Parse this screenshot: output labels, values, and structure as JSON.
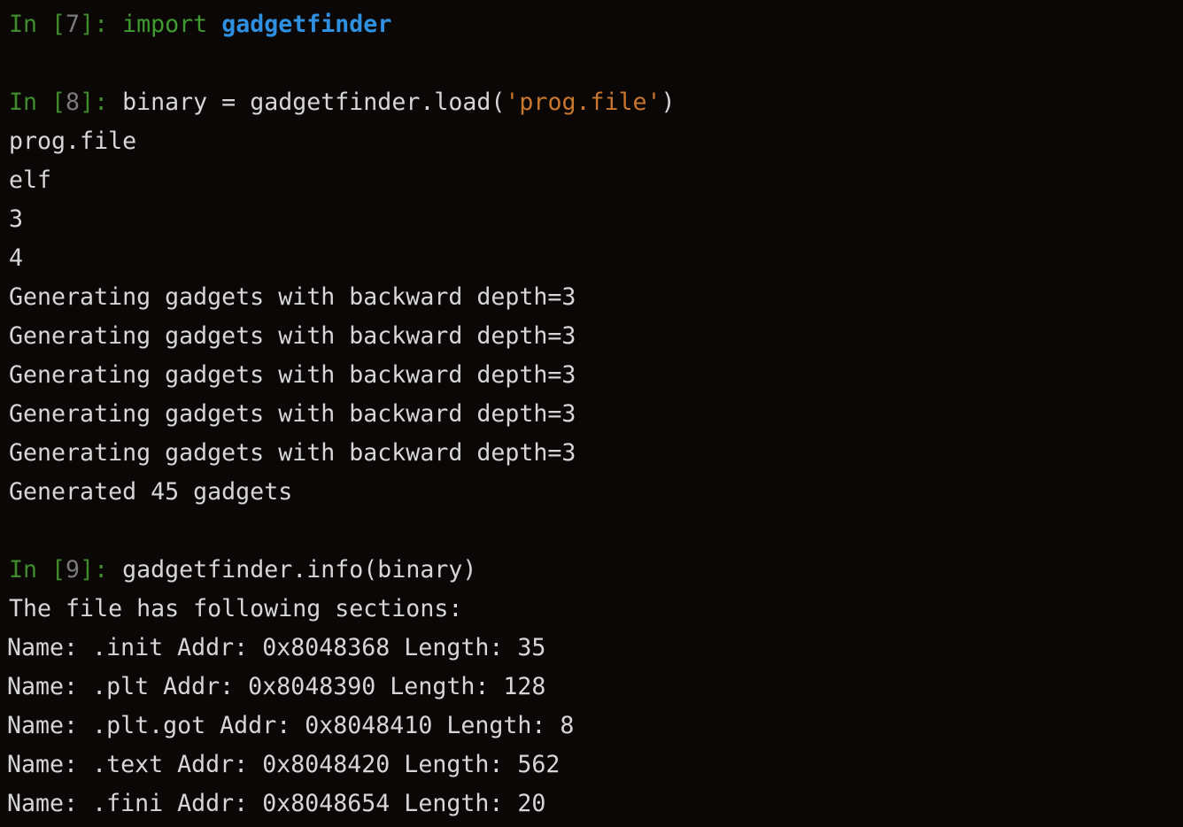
{
  "cells": [
    {
      "prompt_in": "In [",
      "prompt_num": "7",
      "prompt_close": "]: ",
      "code_keyword": "import",
      "code_space": " ",
      "code_module": "gadgetfinder"
    },
    {
      "prompt_in": "In [",
      "prompt_num": "8",
      "prompt_close": "]: ",
      "code_before": "binary = gadgetfinder.load(",
      "code_string": "'prog.file'",
      "code_after": ")",
      "output": [
        "prog.file",
        "elf",
        "3",
        "4",
        "Generating gadgets with backward depth=3",
        "Generating gadgets with backward depth=3",
        "Generating gadgets with backward depth=3",
        "Generating gadgets with backward depth=3",
        "Generating gadgets with backward depth=3",
        "Generated 45 gadgets"
      ]
    },
    {
      "prompt_in": "In [",
      "prompt_num": "9",
      "prompt_close": "]: ",
      "code": "gadgetfinder.info(binary)",
      "output_header": "The file has following sections:",
      "sections": [
        "Name: .init Addr: 0x8048368 Length: 35",
        "Name: .plt Addr: 0x8048390 Length: 128",
        "Name: .plt.got Addr: 0x8048410 Length: 8",
        "Name: .text Addr: 0x8048420 Length: 562",
        "Name: .fini Addr: 0x8048654 Length: 20"
      ]
    }
  ],
  "colors": {
    "background": "#0b0706",
    "prompt": "#3f8a2c",
    "prompt_number": "#7a7a7a",
    "keyword": "#3f9b30",
    "module": "#2f8fe0",
    "string": "#c7772f",
    "text": "#d6d6d6"
  }
}
